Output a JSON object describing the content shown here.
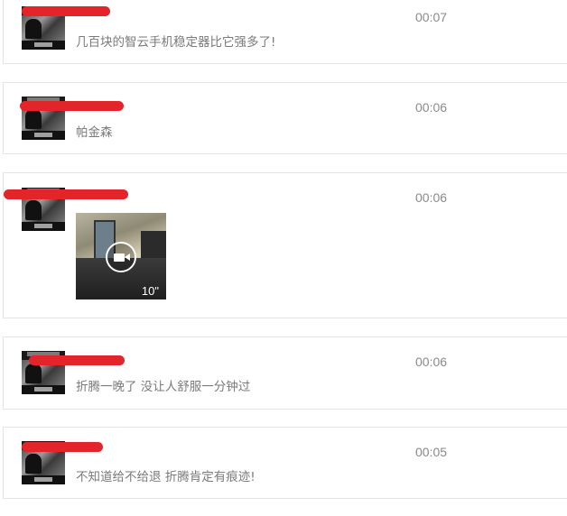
{
  "comments": [
    {
      "time": "00:07",
      "text": "几百块的智云手机稳定器比它强多了!"
    },
    {
      "time": "00:06",
      "text": "帕金森"
    },
    {
      "time": "00:06",
      "text": "",
      "video": {
        "duration": "10\""
      }
    },
    {
      "time": "00:06",
      "text": "折腾一晚了 没让人舒服一分钟过"
    },
    {
      "time": "00:05",
      "text": "不知道给不给退 折腾肯定有痕迹!"
    }
  ]
}
